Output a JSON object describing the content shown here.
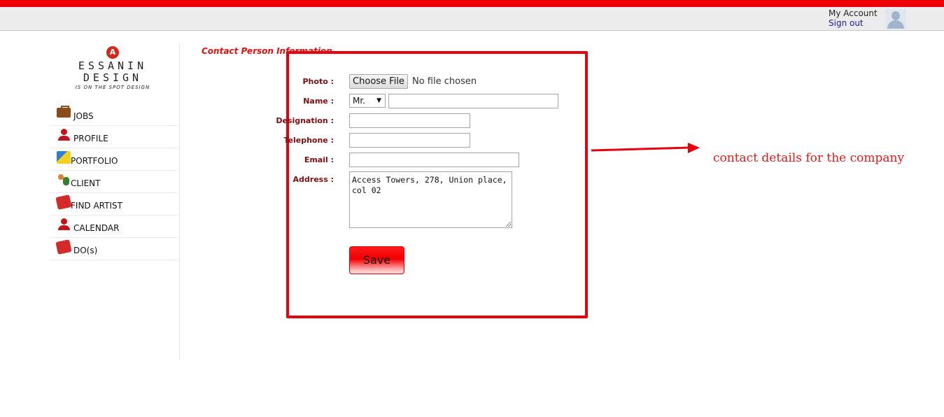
{
  "header": {
    "my_account": "My Account",
    "sign_out": "Sign out"
  },
  "logo": {
    "line1": "ESSANIN",
    "line2": "DESIGN",
    "tagline": "IS ON THE SPOT DESIGN"
  },
  "nav": {
    "items": [
      {
        "label": "JOBS",
        "icon": "briefcase-icon"
      },
      {
        "label": "PROFILE",
        "icon": "person-icon"
      },
      {
        "label": "PORTFOLIO",
        "icon": "portfolio-icon"
      },
      {
        "label": "CLIENT",
        "icon": "client-icon"
      },
      {
        "label": "FIND ARTIST",
        "icon": "folder-icon"
      },
      {
        "label": "CALENDAR",
        "icon": "person-icon"
      },
      {
        "label": "DO(s)",
        "icon": "folder-icon"
      }
    ]
  },
  "form": {
    "section_title": "Contact Person Information",
    "photo_label": "Photo :",
    "file_button": "Choose File",
    "file_status": "No file chosen",
    "name_label": "Name :",
    "title_value": "Mr.",
    "name_value": "",
    "designation_label": "Designation :",
    "designation_value": "",
    "telephone_label": "Telephone :",
    "telephone_value": "",
    "email_label": "Email :",
    "email_value": "",
    "address_label": "Address :",
    "address_value": "Access Towers, 278, Union place, col 02",
    "save_label": "Save"
  },
  "annotation": {
    "note": "contact details for the company",
    "color": "#e01a1a"
  }
}
